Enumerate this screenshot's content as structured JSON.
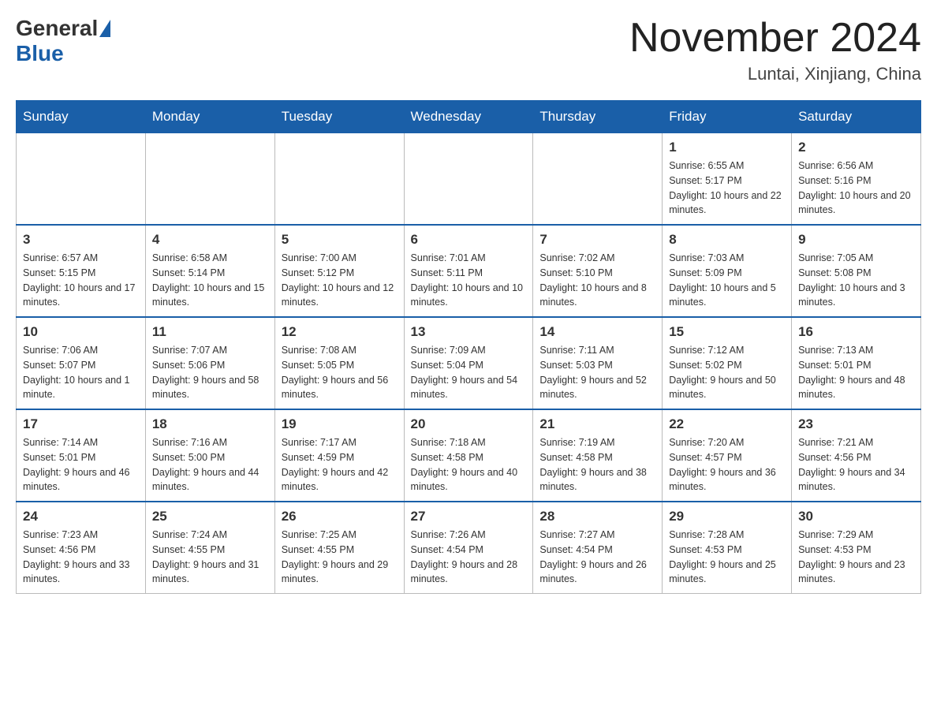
{
  "header": {
    "logo_general": "General",
    "logo_blue": "Blue",
    "month_title": "November 2024",
    "location": "Luntai, Xinjiang, China"
  },
  "days_of_week": [
    "Sunday",
    "Monday",
    "Tuesday",
    "Wednesday",
    "Thursday",
    "Friday",
    "Saturday"
  ],
  "weeks": [
    [
      {
        "day": "",
        "info": ""
      },
      {
        "day": "",
        "info": ""
      },
      {
        "day": "",
        "info": ""
      },
      {
        "day": "",
        "info": ""
      },
      {
        "day": "",
        "info": ""
      },
      {
        "day": "1",
        "info": "Sunrise: 6:55 AM\nSunset: 5:17 PM\nDaylight: 10 hours and 22 minutes."
      },
      {
        "day": "2",
        "info": "Sunrise: 6:56 AM\nSunset: 5:16 PM\nDaylight: 10 hours and 20 minutes."
      }
    ],
    [
      {
        "day": "3",
        "info": "Sunrise: 6:57 AM\nSunset: 5:15 PM\nDaylight: 10 hours and 17 minutes."
      },
      {
        "day": "4",
        "info": "Sunrise: 6:58 AM\nSunset: 5:14 PM\nDaylight: 10 hours and 15 minutes."
      },
      {
        "day": "5",
        "info": "Sunrise: 7:00 AM\nSunset: 5:12 PM\nDaylight: 10 hours and 12 minutes."
      },
      {
        "day": "6",
        "info": "Sunrise: 7:01 AM\nSunset: 5:11 PM\nDaylight: 10 hours and 10 minutes."
      },
      {
        "day": "7",
        "info": "Sunrise: 7:02 AM\nSunset: 5:10 PM\nDaylight: 10 hours and 8 minutes."
      },
      {
        "day": "8",
        "info": "Sunrise: 7:03 AM\nSunset: 5:09 PM\nDaylight: 10 hours and 5 minutes."
      },
      {
        "day": "9",
        "info": "Sunrise: 7:05 AM\nSunset: 5:08 PM\nDaylight: 10 hours and 3 minutes."
      }
    ],
    [
      {
        "day": "10",
        "info": "Sunrise: 7:06 AM\nSunset: 5:07 PM\nDaylight: 10 hours and 1 minute."
      },
      {
        "day": "11",
        "info": "Sunrise: 7:07 AM\nSunset: 5:06 PM\nDaylight: 9 hours and 58 minutes."
      },
      {
        "day": "12",
        "info": "Sunrise: 7:08 AM\nSunset: 5:05 PM\nDaylight: 9 hours and 56 minutes."
      },
      {
        "day": "13",
        "info": "Sunrise: 7:09 AM\nSunset: 5:04 PM\nDaylight: 9 hours and 54 minutes."
      },
      {
        "day": "14",
        "info": "Sunrise: 7:11 AM\nSunset: 5:03 PM\nDaylight: 9 hours and 52 minutes."
      },
      {
        "day": "15",
        "info": "Sunrise: 7:12 AM\nSunset: 5:02 PM\nDaylight: 9 hours and 50 minutes."
      },
      {
        "day": "16",
        "info": "Sunrise: 7:13 AM\nSunset: 5:01 PM\nDaylight: 9 hours and 48 minutes."
      }
    ],
    [
      {
        "day": "17",
        "info": "Sunrise: 7:14 AM\nSunset: 5:01 PM\nDaylight: 9 hours and 46 minutes."
      },
      {
        "day": "18",
        "info": "Sunrise: 7:16 AM\nSunset: 5:00 PM\nDaylight: 9 hours and 44 minutes."
      },
      {
        "day": "19",
        "info": "Sunrise: 7:17 AM\nSunset: 4:59 PM\nDaylight: 9 hours and 42 minutes."
      },
      {
        "day": "20",
        "info": "Sunrise: 7:18 AM\nSunset: 4:58 PM\nDaylight: 9 hours and 40 minutes."
      },
      {
        "day": "21",
        "info": "Sunrise: 7:19 AM\nSunset: 4:58 PM\nDaylight: 9 hours and 38 minutes."
      },
      {
        "day": "22",
        "info": "Sunrise: 7:20 AM\nSunset: 4:57 PM\nDaylight: 9 hours and 36 minutes."
      },
      {
        "day": "23",
        "info": "Sunrise: 7:21 AM\nSunset: 4:56 PM\nDaylight: 9 hours and 34 minutes."
      }
    ],
    [
      {
        "day": "24",
        "info": "Sunrise: 7:23 AM\nSunset: 4:56 PM\nDaylight: 9 hours and 33 minutes."
      },
      {
        "day": "25",
        "info": "Sunrise: 7:24 AM\nSunset: 4:55 PM\nDaylight: 9 hours and 31 minutes."
      },
      {
        "day": "26",
        "info": "Sunrise: 7:25 AM\nSunset: 4:55 PM\nDaylight: 9 hours and 29 minutes."
      },
      {
        "day": "27",
        "info": "Sunrise: 7:26 AM\nSunset: 4:54 PM\nDaylight: 9 hours and 28 minutes."
      },
      {
        "day": "28",
        "info": "Sunrise: 7:27 AM\nSunset: 4:54 PM\nDaylight: 9 hours and 26 minutes."
      },
      {
        "day": "29",
        "info": "Sunrise: 7:28 AM\nSunset: 4:53 PM\nDaylight: 9 hours and 25 minutes."
      },
      {
        "day": "30",
        "info": "Sunrise: 7:29 AM\nSunset: 4:53 PM\nDaylight: 9 hours and 23 minutes."
      }
    ]
  ]
}
